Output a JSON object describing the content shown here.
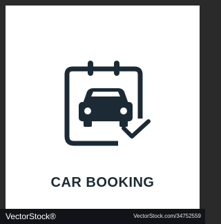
{
  "title": "CAR BOOKING",
  "icon": {
    "name": "car-booking-icon",
    "stroke_color": "#1b2a35"
  },
  "footer": {
    "brand": "VectorStock®",
    "url": "VectorStock.com/34752559"
  }
}
